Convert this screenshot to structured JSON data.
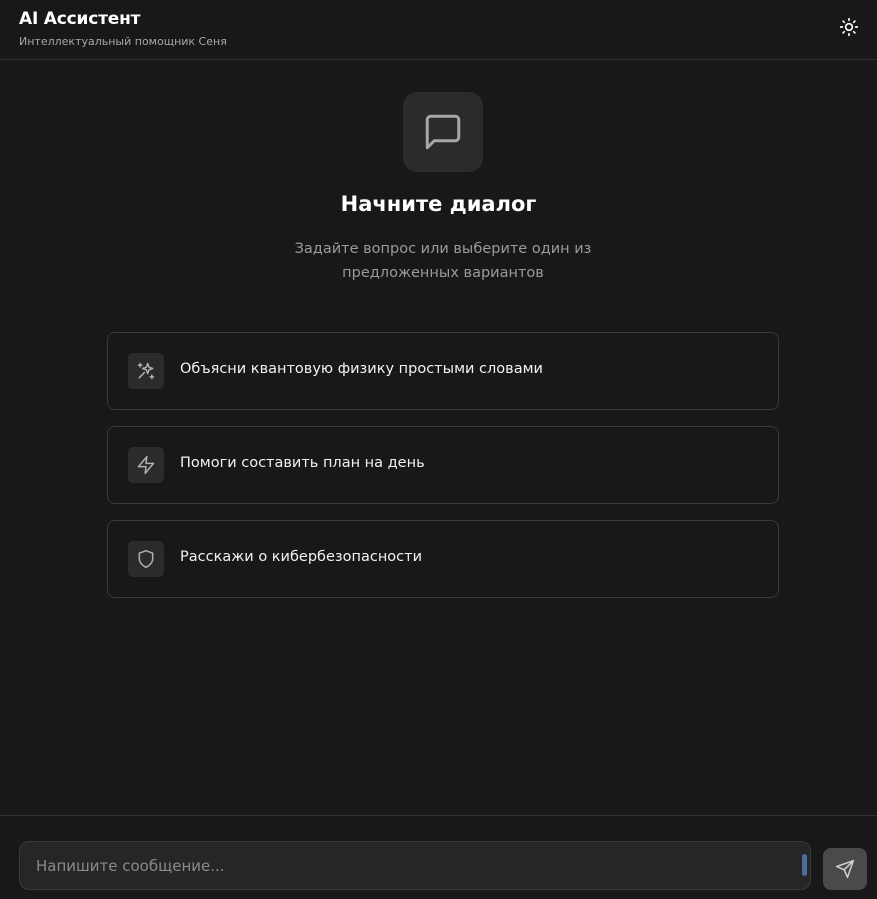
{
  "header": {
    "title": "AI Ассистент",
    "subtitle": "Интеллектуальный помощник Сеня",
    "theme_icon": "sun-icon"
  },
  "empty_state": {
    "icon": "message-square-icon",
    "title": "Начните диалог",
    "subtitle": "Задайте вопрос или выберите один из предложенных вариантов"
  },
  "suggestions": [
    {
      "icon": "sparkles-icon",
      "label": "Объясни квантовую физику простыми словами"
    },
    {
      "icon": "zap-icon",
      "label": "Помоги составить план на день"
    },
    {
      "icon": "shield-icon",
      "label": "Расскажи о кибербезопасности"
    }
  ],
  "composer": {
    "placeholder": "Напишите сообщение...",
    "value": "",
    "send_icon": "send-icon"
  },
  "colors": {
    "background": "#181818",
    "card": "#2b2b2b",
    "border": "#3a3a3a",
    "text": "#ffffff",
    "muted": "#9a9a9a"
  }
}
